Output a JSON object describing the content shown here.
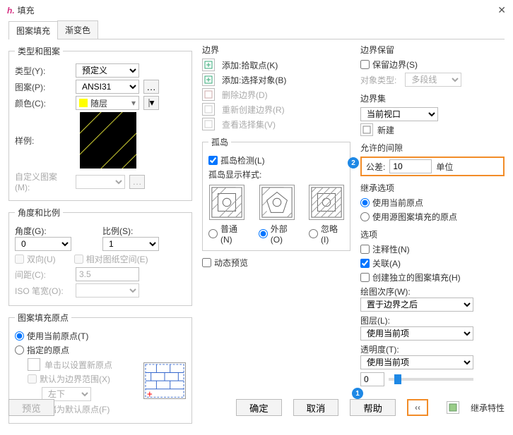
{
  "window": {
    "title": "填充",
    "close": "✕"
  },
  "tabs": [
    "图案填充",
    "渐变色"
  ],
  "typeGroup": {
    "legend": "类型和图案",
    "typeLabel": "类型(Y):",
    "typeValue": "预定义",
    "patternLabel": "图案(P):",
    "patternValue": "ANSI31",
    "colorLabel": "颜色(C):",
    "colorValue": "随层",
    "sampleLabel": "样例:",
    "customLabel": "自定义图案(M):"
  },
  "angleGroup": {
    "legend": "角度和比例",
    "angleLabel": "角度(G):",
    "angleValue": "0",
    "scaleLabel": "比例(S):",
    "scaleValue": "1",
    "doubleLabel": "双向(U)",
    "relPaperLabel": "相对图纸空间(E)",
    "spacingLabel": "间距(C):",
    "spacingValue": "3.5",
    "isoPenLabel": "ISO 笔宽(O):"
  },
  "originGroup": {
    "legend": "图案填充原点",
    "useCurrent": "使用当前原点(T)",
    "specify": "指定的原点",
    "clickSet": "单击以设置新原点",
    "defaultExtent": "默认为边界范围(X)",
    "bottomLeft": "左下",
    "storeDefault": "存储为默认原点(F)"
  },
  "boundary": {
    "title": "边界",
    "addPick": "添加:拾取点(K)",
    "addSelect": "添加:选择对象(B)",
    "remove": "删除边界(D)",
    "recreate": "重新创建边界(R)",
    "viewSel": "查看选择集(V)"
  },
  "island": {
    "title": "孤岛",
    "detect": "孤岛检测(L)",
    "styleLabel": "孤岛显示样式:",
    "normal": "普通(N)",
    "outer": "外部(O)",
    "ignore": "忽略(I)"
  },
  "dynamicPreview": "动态预览",
  "retain": {
    "title": "边界保留",
    "keep": "保留边界(S)",
    "objTypeLabel": "对象类型:",
    "objType": "多段线"
  },
  "bset": {
    "title": "边界集",
    "current": "当前视口",
    "new": "新建"
  },
  "tol": {
    "title": "允许的间隙",
    "tolLabel": "公差:",
    "value": "10",
    "unit": "单位"
  },
  "inherit": {
    "title": "继承选项",
    "useCurrent": "使用当前原点",
    "useSource": "使用源图案填充的原点"
  },
  "options": {
    "title": "选项",
    "annotative": "注释性(N)",
    "assoc": "关联(A)",
    "independent": "创建独立的图案填充(H)",
    "drawOrderLabel": "绘图次序(W):",
    "drawOrder": "置于边界之后",
    "layerLabel": "图层(L):",
    "layer": "使用当前项",
    "transparencyLabel": "透明度(T):",
    "transparency": "使用当前项",
    "transValue": "0"
  },
  "inheritProps": "继承特性",
  "buttons": {
    "preview": "预览",
    "ok": "确定",
    "cancel": "取消",
    "help": "帮助",
    "collapse": "‹‹"
  }
}
